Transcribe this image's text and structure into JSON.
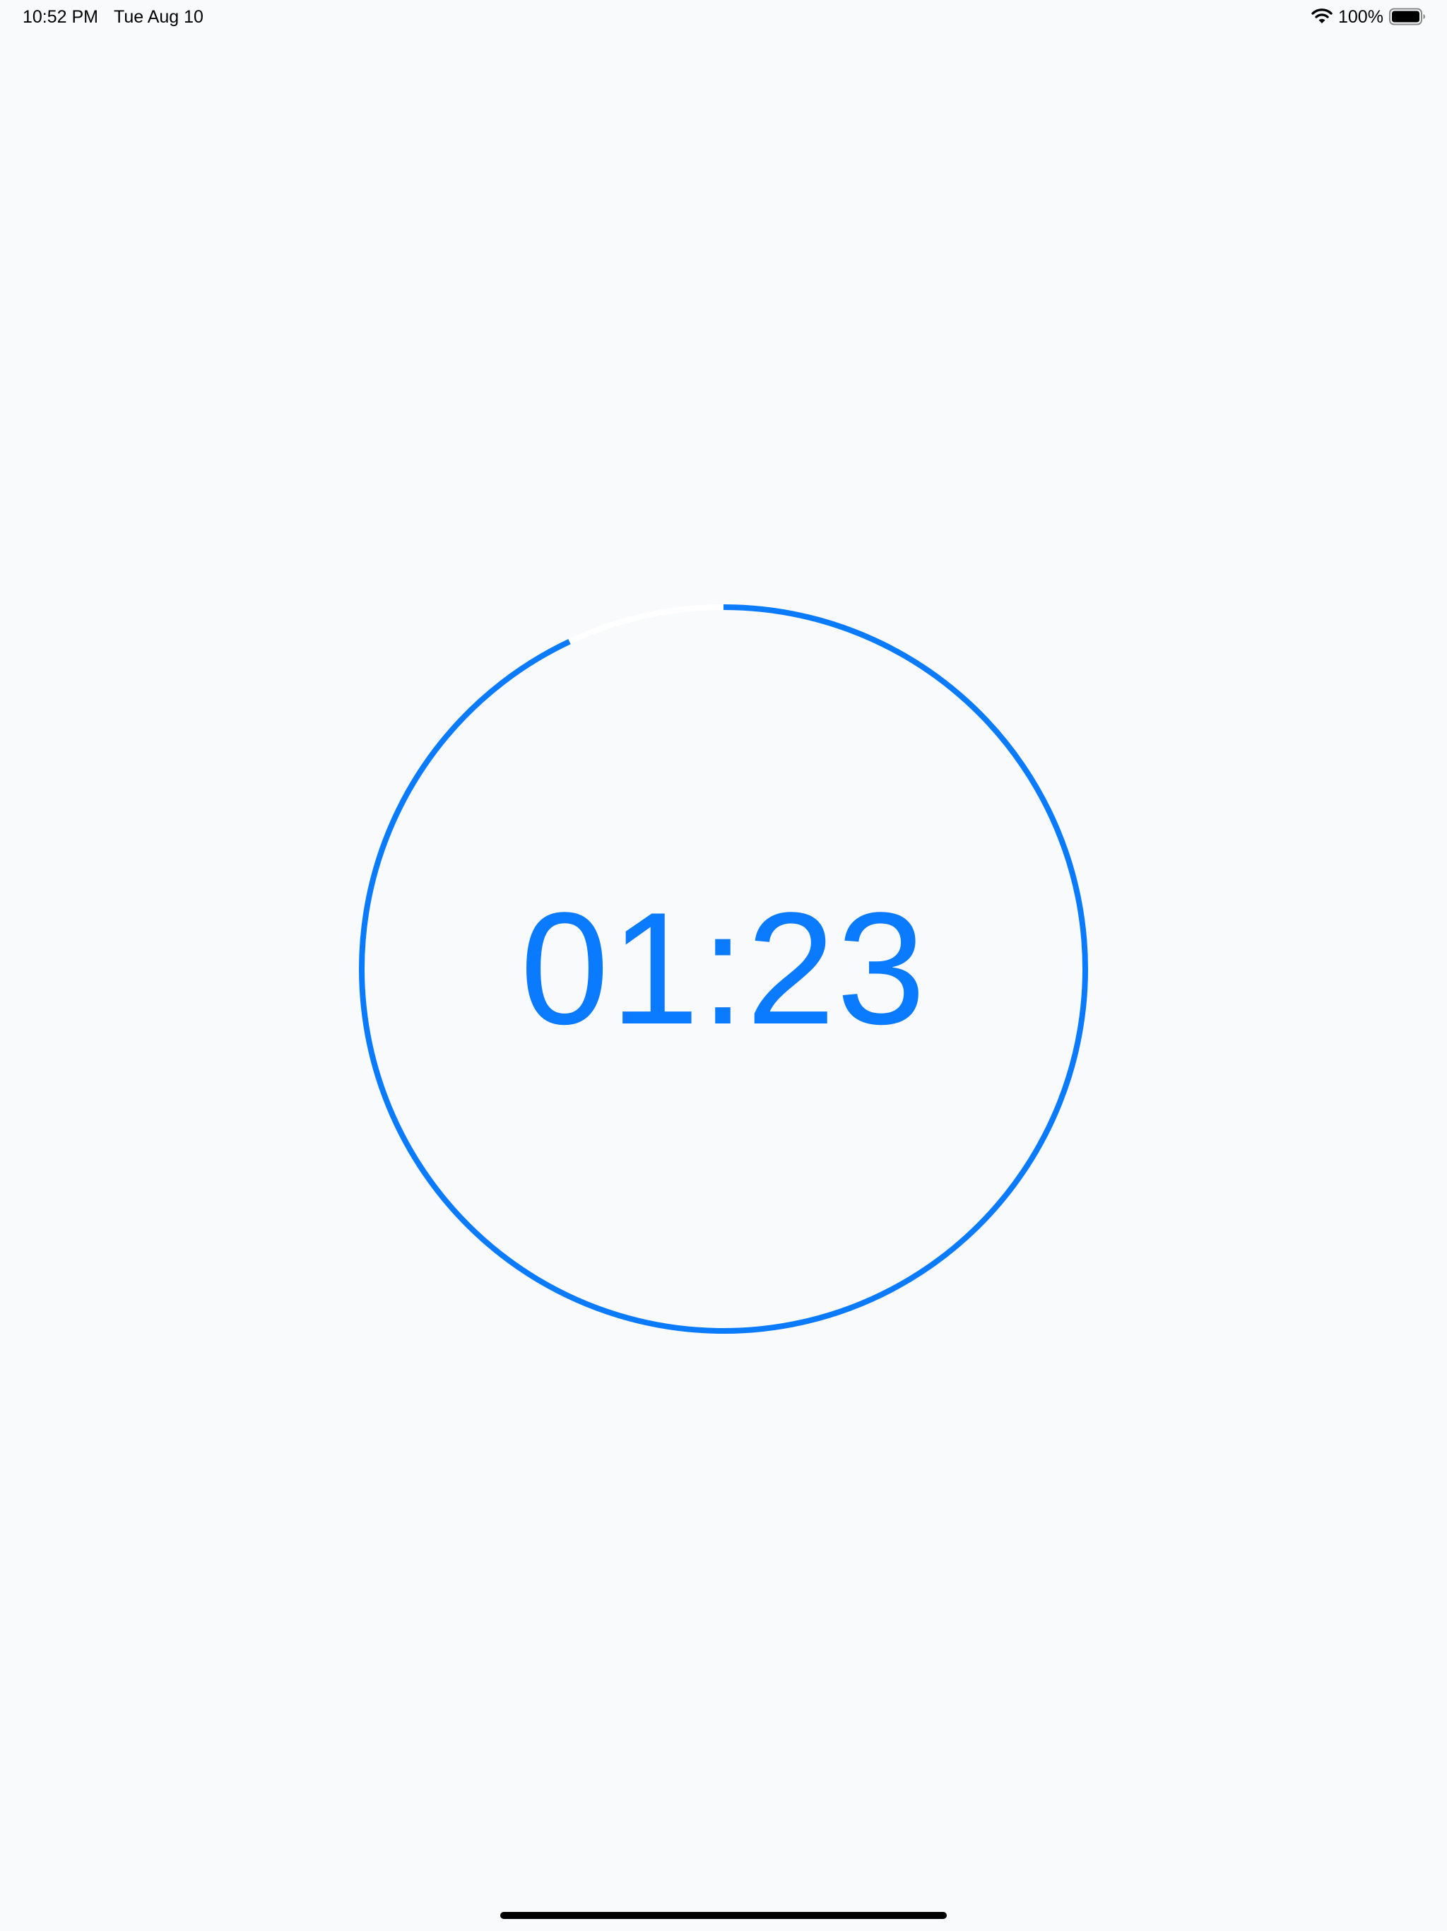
{
  "status_bar": {
    "time": "10:52 PM",
    "date": "Tue Aug 10",
    "battery_percent": "100%",
    "icons": [
      "wifi-icon",
      "battery-icon"
    ]
  },
  "timer": {
    "display": "01:23",
    "progress_fraction": 0.93,
    "accent_color": "#0a7aff",
    "track_color": "#ffffff"
  },
  "colors": {
    "background": "#f9fafb",
    "accent": "#0a7aff"
  }
}
